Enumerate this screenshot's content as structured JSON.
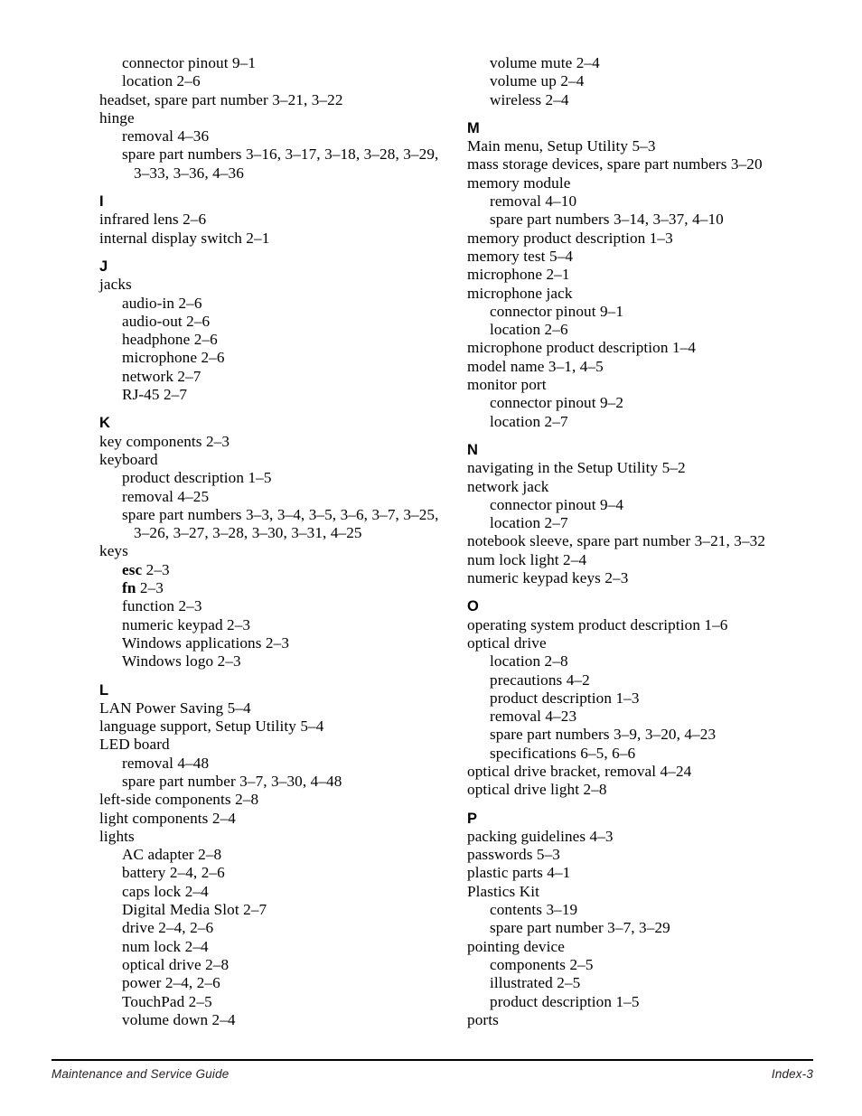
{
  "page": {
    "type": "index",
    "footer": {
      "left_text": "Maintenance and Service Guide",
      "right_text": "Index-3"
    }
  },
  "columns": {
    "left": [
      {
        "kind": "entry",
        "level": 1,
        "text": "connector pinout 9–1"
      },
      {
        "kind": "entry",
        "level": 1,
        "text": "location 2–6"
      },
      {
        "kind": "entry",
        "level": 0,
        "text": "headset, spare part number 3–21, 3–22"
      },
      {
        "kind": "entry",
        "level": 0,
        "text": "hinge"
      },
      {
        "kind": "entry",
        "level": 1,
        "text": "removal 4–36"
      },
      {
        "kind": "entry",
        "level": 1,
        "text": "spare part numbers 3–16, 3–17, 3–18, 3–28, 3–29,",
        "cont": "3–33, 3–36, 4–36"
      },
      {
        "kind": "letter",
        "text": "I"
      },
      {
        "kind": "entry",
        "level": 0,
        "text": "infrared lens 2–6"
      },
      {
        "kind": "entry",
        "level": 0,
        "text": "internal display switch 2–1"
      },
      {
        "kind": "letter",
        "text": "J"
      },
      {
        "kind": "entry",
        "level": 0,
        "text": "jacks"
      },
      {
        "kind": "entry",
        "level": 1,
        "text": "audio-in 2–6"
      },
      {
        "kind": "entry",
        "level": 1,
        "text": "audio-out 2–6"
      },
      {
        "kind": "entry",
        "level": 1,
        "text": "headphone 2–6"
      },
      {
        "kind": "entry",
        "level": 1,
        "text": "microphone 2–6"
      },
      {
        "kind": "entry",
        "level": 1,
        "text": "network 2–7"
      },
      {
        "kind": "entry",
        "level": 1,
        "text": "RJ-45 2–7"
      },
      {
        "kind": "letter",
        "text": "K"
      },
      {
        "kind": "entry",
        "level": 0,
        "text": "key components 2–3"
      },
      {
        "kind": "entry",
        "level": 0,
        "text": "keyboard"
      },
      {
        "kind": "entry",
        "level": 1,
        "text": "product description 1–5"
      },
      {
        "kind": "entry",
        "level": 1,
        "text": "removal 4–25"
      },
      {
        "kind": "entry",
        "level": 1,
        "text": "spare part numbers 3–3, 3–4, 3–5, 3–6, 3–7, 3–25,",
        "cont": "3–26, 3–27, 3–28, 3–30, 3–31, 4–25"
      },
      {
        "kind": "entry",
        "level": 0,
        "text": "keys"
      },
      {
        "kind": "entry",
        "level": 1,
        "text": "esc 2–3",
        "bold_prefix": "esc"
      },
      {
        "kind": "entry",
        "level": 1,
        "text": "fn 2–3",
        "bold_prefix": "fn"
      },
      {
        "kind": "entry",
        "level": 1,
        "text": "function 2–3"
      },
      {
        "kind": "entry",
        "level": 1,
        "text": "numeric keypad 2–3"
      },
      {
        "kind": "entry",
        "level": 1,
        "text": "Windows applications 2–3"
      },
      {
        "kind": "entry",
        "level": 1,
        "text": "Windows logo 2–3"
      },
      {
        "kind": "letter",
        "text": "L"
      },
      {
        "kind": "entry",
        "level": 0,
        "text": "LAN Power Saving 5–4"
      },
      {
        "kind": "entry",
        "level": 0,
        "text": "language support, Setup Utility 5–4"
      },
      {
        "kind": "entry",
        "level": 0,
        "text": "LED board"
      },
      {
        "kind": "entry",
        "level": 1,
        "text": "removal 4–48"
      },
      {
        "kind": "entry",
        "level": 1,
        "text": "spare part number 3–7, 3–30, 4–48"
      },
      {
        "kind": "entry",
        "level": 0,
        "text": "left-side components 2–8"
      },
      {
        "kind": "entry",
        "level": 0,
        "text": "light components 2–4"
      },
      {
        "kind": "entry",
        "level": 0,
        "text": "lights"
      },
      {
        "kind": "entry",
        "level": 1,
        "text": "AC adapter 2–8"
      },
      {
        "kind": "entry",
        "level": 1,
        "text": "battery 2–4, 2–6"
      },
      {
        "kind": "entry",
        "level": 1,
        "text": "caps lock 2–4"
      },
      {
        "kind": "entry",
        "level": 1,
        "text": "Digital Media Slot 2–7"
      },
      {
        "kind": "entry",
        "level": 1,
        "text": "drive 2–4, 2–6"
      },
      {
        "kind": "entry",
        "level": 1,
        "text": "num lock 2–4"
      },
      {
        "kind": "entry",
        "level": 1,
        "text": "optical drive 2–8"
      },
      {
        "kind": "entry",
        "level": 1,
        "text": "power 2–4, 2–6"
      },
      {
        "kind": "entry",
        "level": 1,
        "text": "TouchPad 2–5"
      },
      {
        "kind": "entry",
        "level": 1,
        "text": "volume down 2–4"
      }
    ],
    "right": [
      {
        "kind": "entry",
        "level": 1,
        "text": "volume mute 2–4"
      },
      {
        "kind": "entry",
        "level": 1,
        "text": "volume up 2–4"
      },
      {
        "kind": "entry",
        "level": 1,
        "text": "wireless 2–4"
      },
      {
        "kind": "letter",
        "text": "M"
      },
      {
        "kind": "entry",
        "level": 0,
        "text": "Main menu, Setup Utility 5–3"
      },
      {
        "kind": "entry",
        "level": 0,
        "text": "mass storage devices, spare part numbers 3–20"
      },
      {
        "kind": "entry",
        "level": 0,
        "text": "memory module"
      },
      {
        "kind": "entry",
        "level": 1,
        "text": "removal 4–10"
      },
      {
        "kind": "entry",
        "level": 1,
        "text": "spare part numbers 3–14, 3–37, 4–10"
      },
      {
        "kind": "entry",
        "level": 0,
        "text": "memory product description 1–3"
      },
      {
        "kind": "entry",
        "level": 0,
        "text": "memory test 5–4"
      },
      {
        "kind": "entry",
        "level": 0,
        "text": "microphone 2–1"
      },
      {
        "kind": "entry",
        "level": 0,
        "text": "microphone jack"
      },
      {
        "kind": "entry",
        "level": 1,
        "text": "connector pinout 9–1"
      },
      {
        "kind": "entry",
        "level": 1,
        "text": "location 2–6"
      },
      {
        "kind": "entry",
        "level": 0,
        "text": "microphone product description 1–4"
      },
      {
        "kind": "entry",
        "level": 0,
        "text": "model name 3–1, 4–5"
      },
      {
        "kind": "entry",
        "level": 0,
        "text": "monitor port"
      },
      {
        "kind": "entry",
        "level": 1,
        "text": "connector pinout 9–2"
      },
      {
        "kind": "entry",
        "level": 1,
        "text": "location 2–7"
      },
      {
        "kind": "letter",
        "text": "N"
      },
      {
        "kind": "entry",
        "level": 0,
        "text": "navigating in the Setup Utility 5–2"
      },
      {
        "kind": "entry",
        "level": 0,
        "text": "network jack"
      },
      {
        "kind": "entry",
        "level": 1,
        "text": "connector pinout 9–4"
      },
      {
        "kind": "entry",
        "level": 1,
        "text": "location 2–7"
      },
      {
        "kind": "entry",
        "level": 0,
        "text": "notebook sleeve, spare part number 3–21, 3–32"
      },
      {
        "kind": "entry",
        "level": 0,
        "text": "num lock light 2–4"
      },
      {
        "kind": "entry",
        "level": 0,
        "text": "numeric keypad keys 2–3"
      },
      {
        "kind": "letter",
        "text": "O"
      },
      {
        "kind": "entry",
        "level": 0,
        "text": "operating system product description 1–6"
      },
      {
        "kind": "entry",
        "level": 0,
        "text": "optical drive"
      },
      {
        "kind": "entry",
        "level": 1,
        "text": "location 2–8"
      },
      {
        "kind": "entry",
        "level": 1,
        "text": "precautions 4–2"
      },
      {
        "kind": "entry",
        "level": 1,
        "text": "product description 1–3"
      },
      {
        "kind": "entry",
        "level": 1,
        "text": "removal 4–23"
      },
      {
        "kind": "entry",
        "level": 1,
        "text": "spare part numbers 3–9, 3–20, 4–23"
      },
      {
        "kind": "entry",
        "level": 1,
        "text": "specifications 6–5, 6–6"
      },
      {
        "kind": "entry",
        "level": 0,
        "text": "optical drive bracket, removal 4–24"
      },
      {
        "kind": "entry",
        "level": 0,
        "text": "optical drive light 2–8"
      },
      {
        "kind": "letter",
        "text": "P"
      },
      {
        "kind": "entry",
        "level": 0,
        "text": "packing guidelines 4–3"
      },
      {
        "kind": "entry",
        "level": 0,
        "text": "passwords 5–3"
      },
      {
        "kind": "entry",
        "level": 0,
        "text": "plastic parts 4–1"
      },
      {
        "kind": "entry",
        "level": 0,
        "text": "Plastics Kit"
      },
      {
        "kind": "entry",
        "level": 1,
        "text": "contents 3–19"
      },
      {
        "kind": "entry",
        "level": 1,
        "text": "spare part number 3–7, 3–29"
      },
      {
        "kind": "entry",
        "level": 0,
        "text": "pointing device"
      },
      {
        "kind": "entry",
        "level": 1,
        "text": "components 2–5"
      },
      {
        "kind": "entry",
        "level": 1,
        "text": "illustrated 2–5"
      },
      {
        "kind": "entry",
        "level": 1,
        "text": "product description 1–5"
      },
      {
        "kind": "entry",
        "level": 0,
        "text": "ports"
      }
    ]
  }
}
